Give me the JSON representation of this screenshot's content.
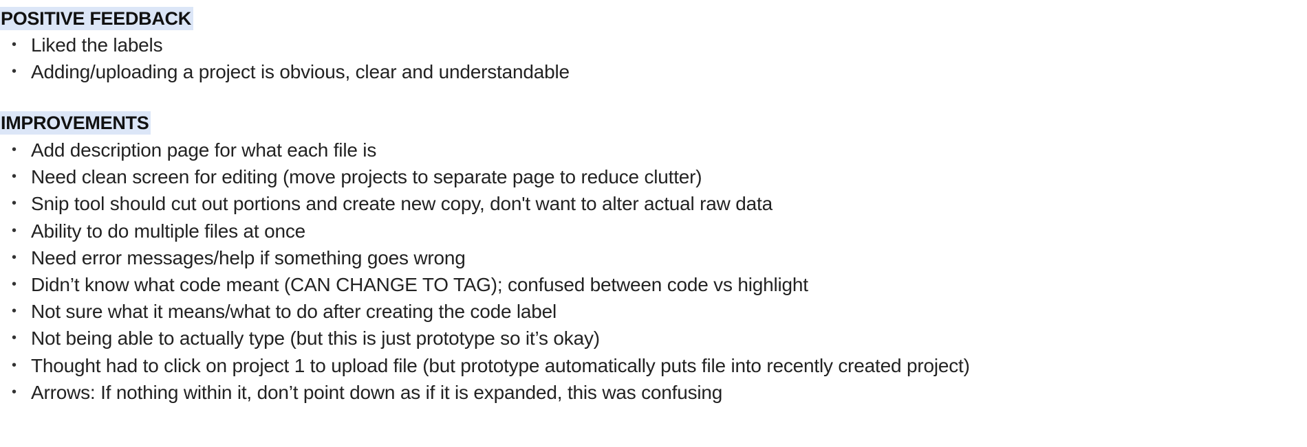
{
  "positive": {
    "heading": "POSITIVE FEEDBACK",
    "items": [
      "Liked the labels",
      "Adding/uploading a project is obvious, clear and understandable"
    ]
  },
  "improvements": {
    "heading": "IMPROVEMENTS",
    "items": [
      "Add description page for what each file is",
      "Need clean screen for editing (move projects to separate page to reduce clutter)",
      "Snip tool should cut out portions and create new copy, don't want to alter actual raw data",
      "Ability to do multiple files at once",
      "Need error messages/help if something goes wrong",
      "Didn’t know what code meant (CAN CHANGE TO TAG); confused between code vs highlight",
      "Not sure what it means/what to do after creating the code label",
      "Not being able to actually type (but this is just prototype so it’s okay)",
      "Thought had to click on project 1 to upload file (but prototype automatically puts file into recently created project)",
      "Arrows: If nothing within it, don’t point down as if it is expanded, this was confusing"
    ]
  },
  "colors": {
    "heading_highlight": "#dce6f7",
    "text": "#222222"
  },
  "bullet_glyph": "•"
}
